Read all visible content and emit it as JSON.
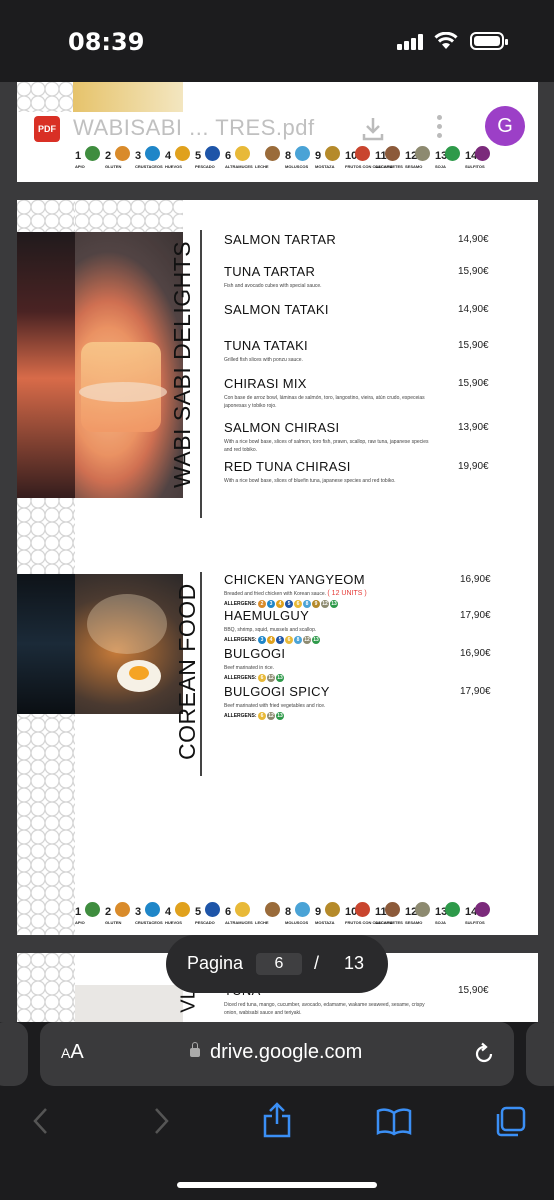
{
  "status_bar": {
    "time": "08:39"
  },
  "pdf_header": {
    "file_name": "WABISABI ... TRES.pdf",
    "pdf_badge": "PDF",
    "avatar_letter": "G"
  },
  "allergen_legend": [
    {
      "n": "1",
      "label": "APIO",
      "color": "#3f8d3f"
    },
    {
      "n": "2",
      "label": "GLUTEN",
      "color": "#d98b2b"
    },
    {
      "n": "3",
      "label": "CRUSTACEOS",
      "color": "#1f86c8"
    },
    {
      "n": "4",
      "label": "HUEVOS",
      "color": "#e0a11d"
    },
    {
      "n": "5",
      "label": "PESCADO",
      "color": "#1e55a8"
    },
    {
      "n": "6",
      "label": "ALTRAMUCES",
      "color": "#e8b938"
    },
    {
      "n": "",
      "label": "LECHE",
      "color": "#9a6b3a"
    },
    {
      "n": "8",
      "label": "MOLUSCOS",
      "color": "#4aa3d6"
    },
    {
      "n": "9",
      "label": "MOSTAZA",
      "color": "#b58a2a"
    },
    {
      "n": "10",
      "label": "FRUTOS CON CASCARA",
      "color": "#c9452e"
    },
    {
      "n": "11",
      "label": "CACAHUETES",
      "color": "#8c5a3a"
    },
    {
      "n": "12",
      "label": "SESAMO",
      "color": "#8d8a70"
    },
    {
      "n": "13",
      "label": "SOJA",
      "color": "#2e9a4a"
    },
    {
      "n": "14",
      "label": "SULFITOS",
      "color": "#7b2a7b"
    }
  ],
  "section1": {
    "title": "WABI SABI DELIGHTS",
    "items": [
      {
        "name": "SALMON TARTAR",
        "price": "14,90€",
        "desc": ""
      },
      {
        "name": "TUNA TARTAR",
        "price": "15,90€",
        "desc": "Fish and avocado cubes with special sauce."
      },
      {
        "name": "SALMON TATAKI",
        "price": "14,90€",
        "desc": ""
      },
      {
        "name": "TUNA TATAKI",
        "price": "15,90€",
        "desc": "Grilled fish slices with ponzu sauce."
      },
      {
        "name": "CHIRASI MIX",
        "price": "15,90€",
        "desc": "Con base de arroz bowl, láminas de salmón, toro, langostino, vieira, atún crudo, especeias japonesas y tobiko rojo."
      },
      {
        "name": "SALMON CHIRASI",
        "price": "13,90€",
        "desc": "With a rice bowl base, slices of salmon, toro fish, prawn, scallop, raw tuna, japanese species and red tobiko."
      },
      {
        "name": "RED TUNA CHIRASI",
        "price": "19,90€",
        "desc": "With a rice bowl base, slices of bluefin tuna, japanese species and red tobiko."
      }
    ]
  },
  "section2": {
    "title": "COREAN FOOD",
    "allergens_label": "ALLERGENS:",
    "items": [
      {
        "name": "CHICKEN YANGYEOM",
        "price": "16,90€",
        "desc": "Breaded and fried chicken with Korean sauce.",
        "units": "( 12 UNITS )",
        "allergens": [
          "2",
          "3",
          "4",
          "5",
          "6",
          "8",
          "9",
          "12",
          "13"
        ]
      },
      {
        "name": "HAEMULGUY",
        "price": "17,90€",
        "desc": "BBQ, shrimp, squid, mussels and scallop.",
        "allergens": [
          "3",
          "4",
          "5",
          "6",
          "8",
          "12",
          "13"
        ]
      },
      {
        "name": "BULGOGI",
        "price": "16,90€",
        "desc": "Beef marinated in rice.",
        "allergens": [
          "6",
          "12",
          "13"
        ]
      },
      {
        "name": "BULGOGI SPICY",
        "price": "17,90€",
        "desc": "Beef marinated with fried vegetables and rice.",
        "allergens": [
          "6",
          "12",
          "13"
        ]
      }
    ]
  },
  "next_page_peek": {
    "item_name": "TUNA",
    "price": "15,90€",
    "desc": "Diced red tuna, mango, cucumber, avocado, edamame, wakame seaweed, sesame, crispy onion, wabisabi sauce and teriyaki.",
    "side_letters": "VL"
  },
  "pager": {
    "label": "Pagina",
    "current": "6",
    "separator": "/",
    "total": "13"
  },
  "browser": {
    "aa_small": "A",
    "aa_big": "A",
    "url": "drive.google.com"
  }
}
